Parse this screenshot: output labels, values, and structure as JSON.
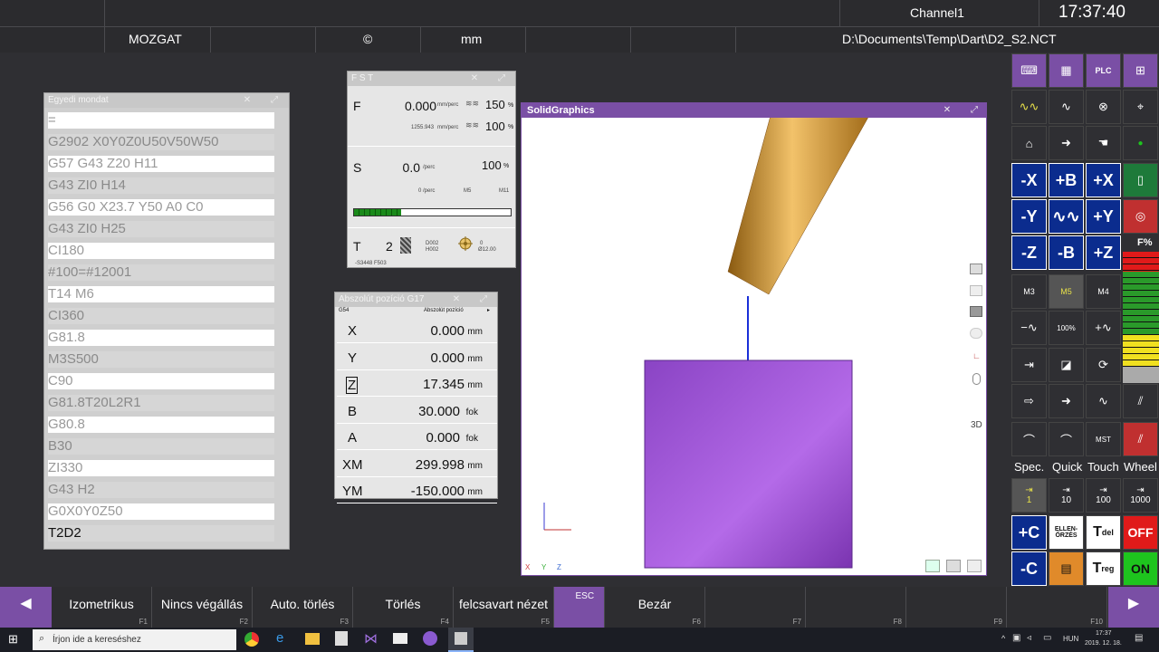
{
  "header": {
    "channel": "Channel1",
    "time": "17:37:40",
    "mode": "MOZGAT",
    "symbol": "©",
    "unit": "mm",
    "file_path": "D:\\Documents\\Temp\\Dart\\D2_S2.NCT"
  },
  "nc_panel": {
    "title": "Egyedi mondat",
    "lines": [
      "=",
      "G2902 X0Y0Z0U50V50W50",
      "G57 G43 Z20 H11",
      "G43 ZI0 H14",
      "G56 G0 X23.7 Y50 A0 C0",
      "G43 ZI0 H25",
      "CI180",
      "#100=#12001",
      "T14 M6",
      "CI360",
      "G81.8",
      "M3S500",
      "C90",
      "G81.8T20L2R1",
      "G80.8",
      "B30",
      "ZI330",
      "G43 H2",
      "G0X0Y0Z50",
      "T2D2"
    ]
  },
  "fst": {
    "title": "F S T",
    "f_label": "F",
    "f_value": "0.000",
    "f_unit": "mm/perc",
    "f_override": "150",
    "f_sub": "1255.943",
    "f_sub_unit": "mm/perc",
    "f_override2": "100",
    "s_label": "S",
    "s_value": "0.0",
    "s_unit": "/perc",
    "s_override": "100",
    "s_sub": "0 /perc",
    "s_m5": "M5",
    "s_m11": "M11",
    "spindle_load": 0.3,
    "t_label": "T",
    "t_value": "2",
    "t_d": "D002",
    "t_h": "H002",
    "t_len": "0",
    "t_dia": "Ø12.00",
    "t_footer": "-S3448 F503",
    "pct": "%"
  },
  "position": {
    "title": "Abszolút pozíció G17",
    "coord_sys": "G54",
    "header_label": "Abszolút pozíció",
    "rows": [
      {
        "axis": "X",
        "value": "0.000",
        "unit": "mm"
      },
      {
        "axis": "Y",
        "value": "0.000",
        "unit": "mm"
      },
      {
        "axis": "Z",
        "value": "17.345",
        "unit": "mm"
      },
      {
        "axis": "B",
        "value": "30.000",
        "unit": "fok"
      },
      {
        "axis": "A",
        "value": "0.000",
        "unit": "fok"
      },
      {
        "axis": "XM",
        "value": "299.998",
        "unit": "mm"
      },
      {
        "axis": "YM",
        "value": "-150.000",
        "unit": "mm"
      }
    ]
  },
  "solid_graphics": {
    "title": "SolidGraphics",
    "view_3d": "3D",
    "axis_x": "X",
    "axis_y": "Y",
    "axis_z": "Z"
  },
  "right_panel": {
    "jog_labels": [
      "-X",
      "+B",
      "+X",
      "-Y",
      "",
      "+Y",
      "-Z",
      "-B",
      "+Z"
    ],
    "m_labels": [
      "M3",
      "M5",
      "M4"
    ],
    "pct100": "100%",
    "f_pct": "F%",
    "mode_labels": [
      "Spec.",
      "Quick",
      "Touch",
      "Wheel"
    ],
    "step_labels": [
      "1",
      "10",
      "100",
      "1000"
    ],
    "c_plus": "+C",
    "c_minus": "-C",
    "ellen": "ELLEN-ŐRZÉS",
    "t_del": "del",
    "t_reg": "reg",
    "off": "OFF",
    "on": "ON",
    "t": "T",
    "feed_levels": 0.55
  },
  "softkeys": [
    {
      "label": "Izometrikus",
      "fkey": "F1"
    },
    {
      "label": "Nincs végállás",
      "fkey": "F2"
    },
    {
      "label": "Auto. törlés",
      "fkey": "F3"
    },
    {
      "label": "Törlés",
      "fkey": "F4"
    },
    {
      "label": "felcsavart nézet",
      "fkey": "F5"
    },
    {
      "label": "ESC",
      "fkey": "F6"
    },
    {
      "label": "Bezár",
      "fkey": "F6"
    },
    {
      "label": "",
      "fkey": "F7"
    },
    {
      "label": "",
      "fkey": "F8"
    },
    {
      "label": "",
      "fkey": "F9"
    },
    {
      "label": "",
      "fkey": "F10"
    }
  ],
  "taskbar": {
    "search_placeholder": "Írjon ide a kereséshez",
    "lang": "HUN",
    "clock_time": "17:37",
    "clock_date": "2019. 12. 18."
  }
}
